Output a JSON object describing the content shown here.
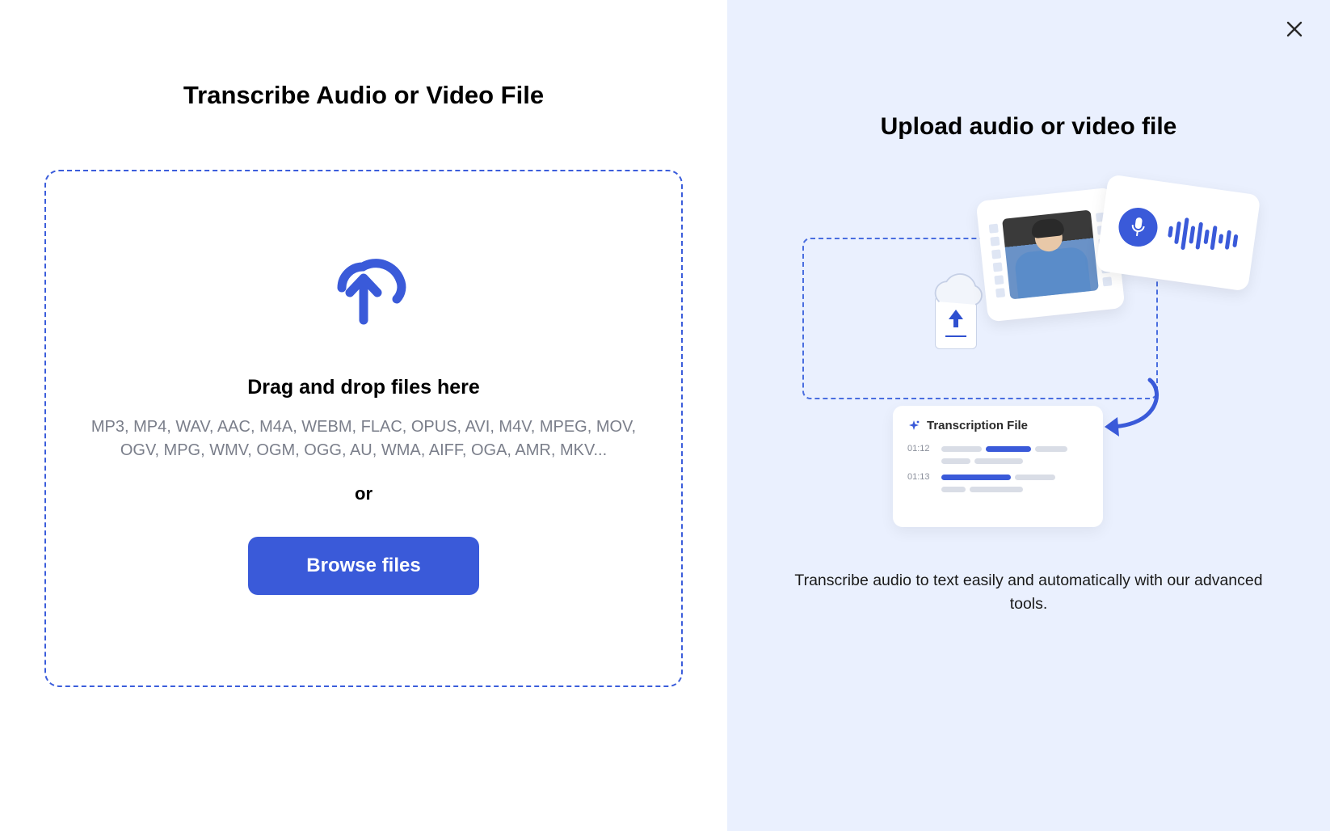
{
  "left": {
    "title": "Transcribe Audio or Video File",
    "drag_text": "Drag and drop files here",
    "formats": "MP3, MP4, WAV, AAC, M4A, WEBM, FLAC, OPUS, AVI, M4V, MPEG, MOV, OGV, MPG, WMV, OGM, OGG, AU, WMA, AIFF, OGA, AMR, MKV...",
    "or": "or",
    "browse_label": "Browse files"
  },
  "right": {
    "title": "Upload audio or video file",
    "transcription_card_title": "Transcription File",
    "time1": "01:12",
    "time2": "01:13",
    "description": "Transcribe audio to text easily and automatically with our advanced tools."
  },
  "colors": {
    "accent": "#3a5ad9",
    "gray_bar": "#d9dde6"
  }
}
